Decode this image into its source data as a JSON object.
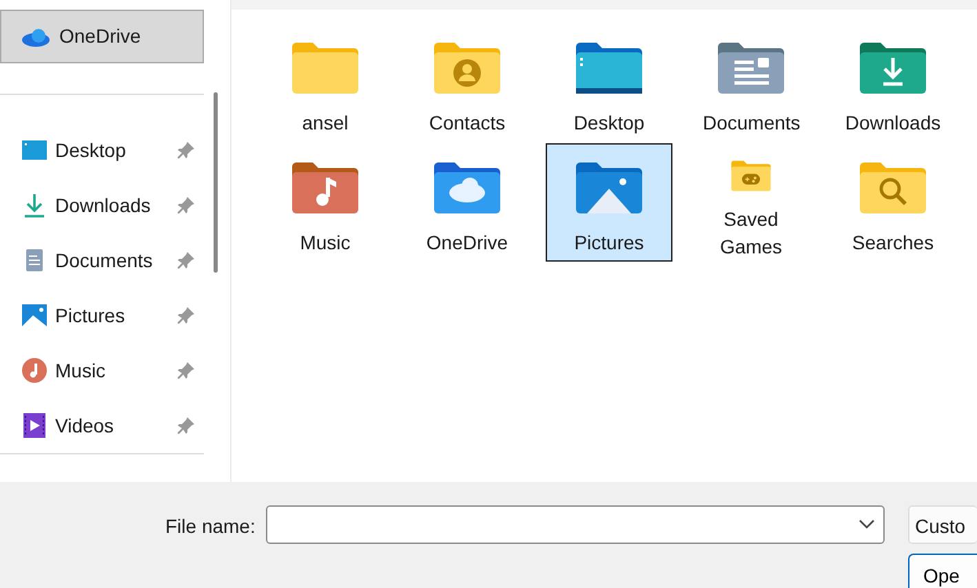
{
  "sidebar": {
    "onedrive": {
      "label": "OneDrive",
      "selected": true
    },
    "quick_access": [
      {
        "label": "Desktop",
        "kind": "desktop",
        "pinned": true
      },
      {
        "label": "Downloads",
        "kind": "downloads",
        "pinned": true
      },
      {
        "label": "Documents",
        "kind": "documents",
        "pinned": true
      },
      {
        "label": "Pictures",
        "kind": "pictures",
        "pinned": true
      },
      {
        "label": "Music",
        "kind": "music",
        "pinned": true
      },
      {
        "label": "Videos",
        "kind": "videos",
        "pinned": true
      }
    ]
  },
  "folders": [
    {
      "name": "ansel",
      "kind": "plain",
      "selected": false
    },
    {
      "name": "Contacts",
      "kind": "contacts",
      "selected": false
    },
    {
      "name": "Desktop",
      "kind": "desktop",
      "selected": false
    },
    {
      "name": "Documents",
      "kind": "documents",
      "selected": false
    },
    {
      "name": "Downloads",
      "kind": "downloads",
      "selected": false
    },
    {
      "name": "Music",
      "kind": "music",
      "selected": false
    },
    {
      "name": "OneDrive",
      "kind": "onedrive",
      "selected": false
    },
    {
      "name": "Pictures",
      "kind": "pictures",
      "selected": true
    },
    {
      "name": "Saved Games",
      "kind": "games",
      "selected": false
    },
    {
      "name": "Searches",
      "kind": "search",
      "selected": false
    }
  ],
  "footer": {
    "file_name_label": "File name:",
    "file_type": "Custo",
    "open_button": "Ope"
  }
}
